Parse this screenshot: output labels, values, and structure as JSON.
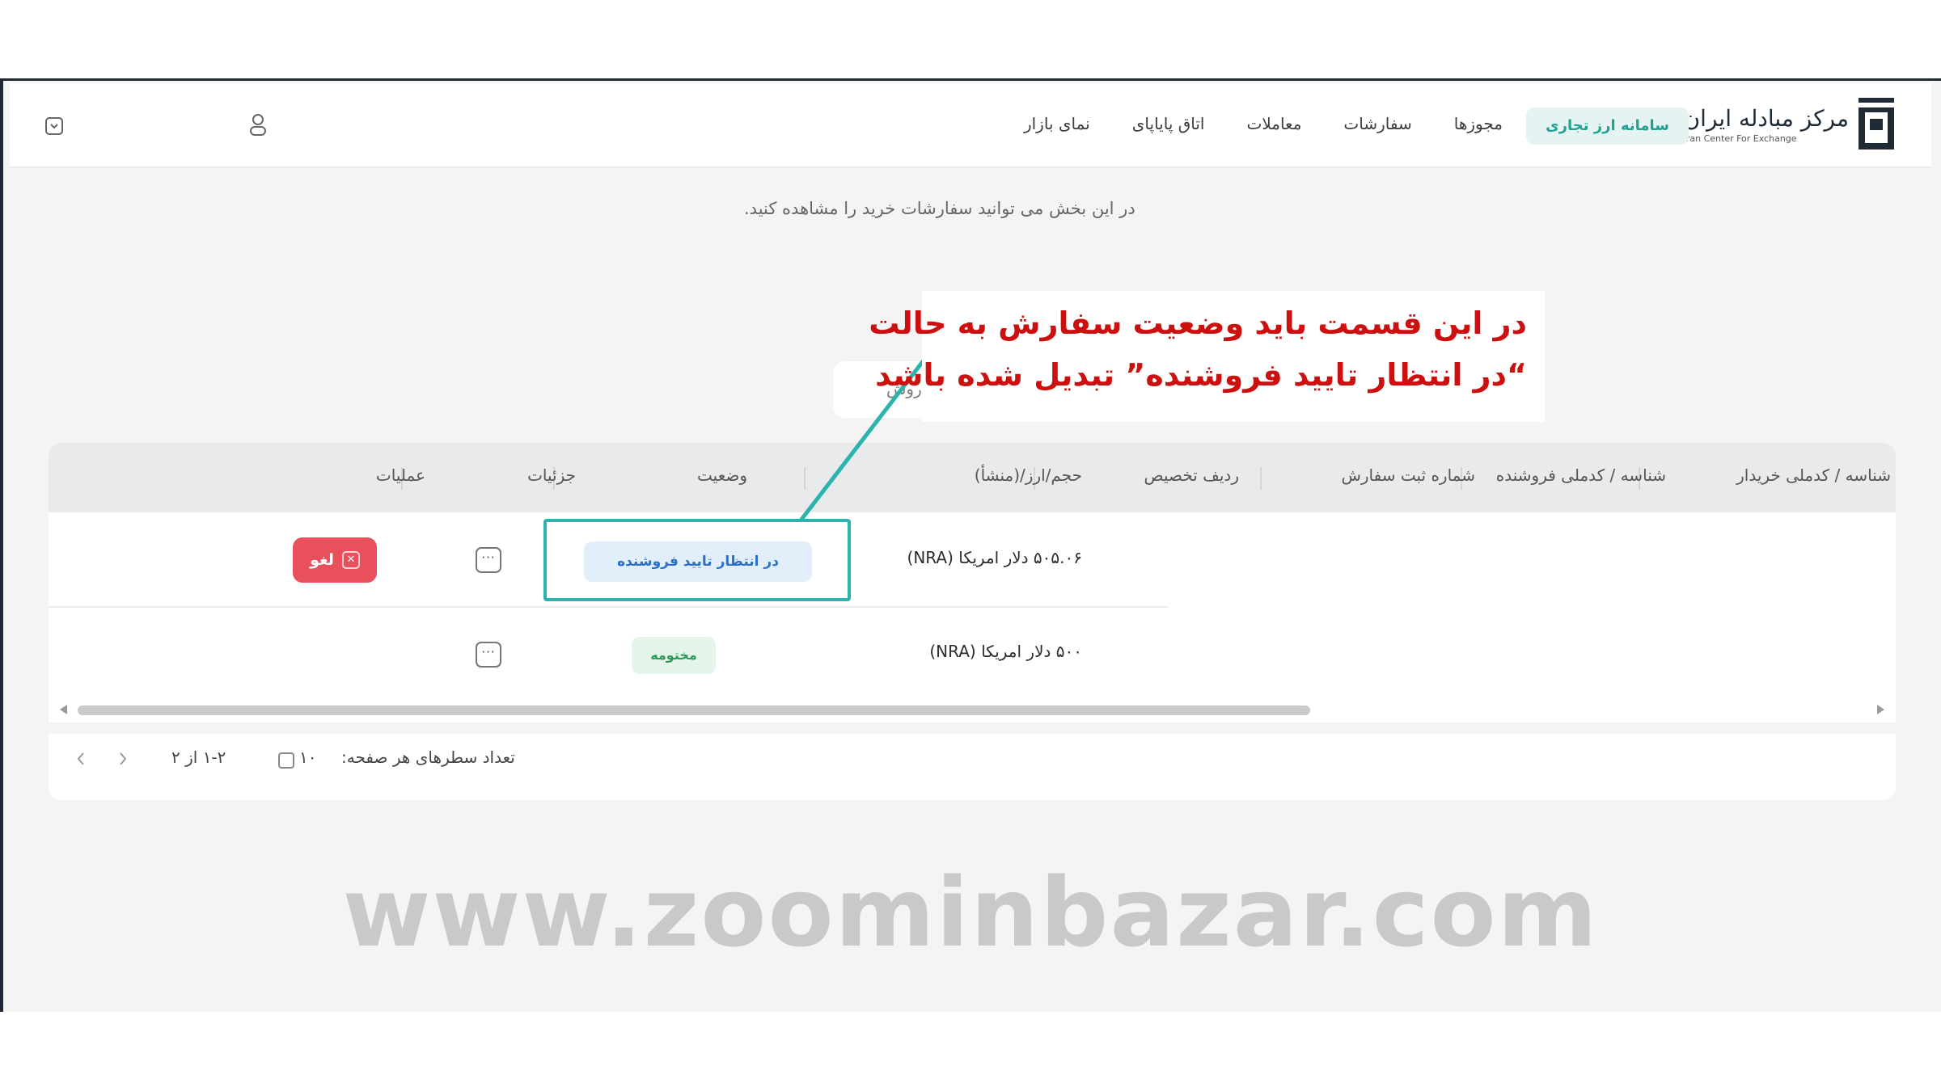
{
  "brand": {
    "logo_fa": "مرکز مبادله ایران",
    "logo_en": "Iran Center For Exchange",
    "colors": {
      "accent": "#20a193",
      "pending": "#2a6fc9",
      "closed": "#2c9a57",
      "cancel": "#e8505b",
      "callout": "#cc1010"
    }
  },
  "nav": {
    "active_label": "سامانه ارز تجاری",
    "items": [
      "مجوزها",
      "سفارشات",
      "معاملات",
      "اتاق پایاپای",
      "نمای بازار"
    ],
    "user_icon": "user-icon",
    "menu_icon": "chevron-down-icon"
  },
  "page": {
    "description": "در این بخش می توانید سفارشات خرید را مشاهده کنید.",
    "search_peek": "روش"
  },
  "callout": {
    "line1": "در این قسمت باید وضعیت سفارش به حالت",
    "line2": "“در انتظار تایید فروشنده” تبدیل شده باشد"
  },
  "table": {
    "columns": [
      "شناسه / کدملی خریدار",
      "شناسه / کدملی فروشنده",
      "شماره ثبت سفارش",
      "ردیف تخصیص",
      "حجم/ارز/(منشأ)",
      "وضعیت",
      "جزئیات",
      "عملیات"
    ],
    "rows": [
      {
        "amount": "۵۰۵.۰۶ دلار امریکا (NRA)",
        "status": "در انتظار تایید فروشنده",
        "details": "···",
        "action": "لغو"
      },
      {
        "amount": "۵۰۰ دلار امریکا (NRA)",
        "status": "مختومه",
        "details": "···",
        "action": ""
      }
    ]
  },
  "pagination": {
    "rows_per_page_label": "تعداد سطرهای هر صفحه:",
    "rows_per_page": "۱۰",
    "range": "۱-۲ از ۲"
  },
  "watermark": "www.zoominbazar.com"
}
